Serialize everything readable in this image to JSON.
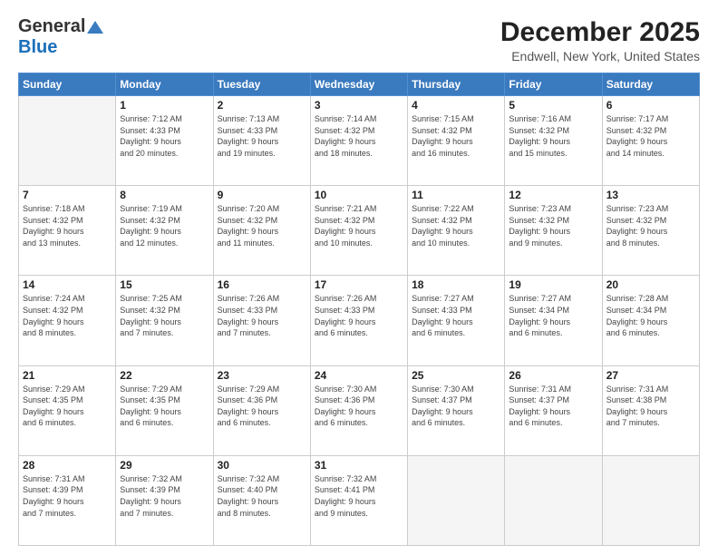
{
  "header": {
    "logo_general": "General",
    "logo_blue": "Blue",
    "main_title": "December 2025",
    "sub_title": "Endwell, New York, United States"
  },
  "days_of_week": [
    "Sunday",
    "Monday",
    "Tuesday",
    "Wednesday",
    "Thursday",
    "Friday",
    "Saturday"
  ],
  "weeks": [
    [
      {
        "day": "",
        "info": ""
      },
      {
        "day": "1",
        "info": "Sunrise: 7:12 AM\nSunset: 4:33 PM\nDaylight: 9 hours\nand 20 minutes."
      },
      {
        "day": "2",
        "info": "Sunrise: 7:13 AM\nSunset: 4:33 PM\nDaylight: 9 hours\nand 19 minutes."
      },
      {
        "day": "3",
        "info": "Sunrise: 7:14 AM\nSunset: 4:32 PM\nDaylight: 9 hours\nand 18 minutes."
      },
      {
        "day": "4",
        "info": "Sunrise: 7:15 AM\nSunset: 4:32 PM\nDaylight: 9 hours\nand 16 minutes."
      },
      {
        "day": "5",
        "info": "Sunrise: 7:16 AM\nSunset: 4:32 PM\nDaylight: 9 hours\nand 15 minutes."
      },
      {
        "day": "6",
        "info": "Sunrise: 7:17 AM\nSunset: 4:32 PM\nDaylight: 9 hours\nand 14 minutes."
      }
    ],
    [
      {
        "day": "7",
        "info": "Sunrise: 7:18 AM\nSunset: 4:32 PM\nDaylight: 9 hours\nand 13 minutes."
      },
      {
        "day": "8",
        "info": "Sunrise: 7:19 AM\nSunset: 4:32 PM\nDaylight: 9 hours\nand 12 minutes."
      },
      {
        "day": "9",
        "info": "Sunrise: 7:20 AM\nSunset: 4:32 PM\nDaylight: 9 hours\nand 11 minutes."
      },
      {
        "day": "10",
        "info": "Sunrise: 7:21 AM\nSunset: 4:32 PM\nDaylight: 9 hours\nand 10 minutes."
      },
      {
        "day": "11",
        "info": "Sunrise: 7:22 AM\nSunset: 4:32 PM\nDaylight: 9 hours\nand 10 minutes."
      },
      {
        "day": "12",
        "info": "Sunrise: 7:23 AM\nSunset: 4:32 PM\nDaylight: 9 hours\nand 9 minutes."
      },
      {
        "day": "13",
        "info": "Sunrise: 7:23 AM\nSunset: 4:32 PM\nDaylight: 9 hours\nand 8 minutes."
      }
    ],
    [
      {
        "day": "14",
        "info": "Sunrise: 7:24 AM\nSunset: 4:32 PM\nDaylight: 9 hours\nand 8 minutes."
      },
      {
        "day": "15",
        "info": "Sunrise: 7:25 AM\nSunset: 4:32 PM\nDaylight: 9 hours\nand 7 minutes."
      },
      {
        "day": "16",
        "info": "Sunrise: 7:26 AM\nSunset: 4:33 PM\nDaylight: 9 hours\nand 7 minutes."
      },
      {
        "day": "17",
        "info": "Sunrise: 7:26 AM\nSunset: 4:33 PM\nDaylight: 9 hours\nand 6 minutes."
      },
      {
        "day": "18",
        "info": "Sunrise: 7:27 AM\nSunset: 4:33 PM\nDaylight: 9 hours\nand 6 minutes."
      },
      {
        "day": "19",
        "info": "Sunrise: 7:27 AM\nSunset: 4:34 PM\nDaylight: 9 hours\nand 6 minutes."
      },
      {
        "day": "20",
        "info": "Sunrise: 7:28 AM\nSunset: 4:34 PM\nDaylight: 9 hours\nand 6 minutes."
      }
    ],
    [
      {
        "day": "21",
        "info": "Sunrise: 7:29 AM\nSunset: 4:35 PM\nDaylight: 9 hours\nand 6 minutes."
      },
      {
        "day": "22",
        "info": "Sunrise: 7:29 AM\nSunset: 4:35 PM\nDaylight: 9 hours\nand 6 minutes."
      },
      {
        "day": "23",
        "info": "Sunrise: 7:29 AM\nSunset: 4:36 PM\nDaylight: 9 hours\nand 6 minutes."
      },
      {
        "day": "24",
        "info": "Sunrise: 7:30 AM\nSunset: 4:36 PM\nDaylight: 9 hours\nand 6 minutes."
      },
      {
        "day": "25",
        "info": "Sunrise: 7:30 AM\nSunset: 4:37 PM\nDaylight: 9 hours\nand 6 minutes."
      },
      {
        "day": "26",
        "info": "Sunrise: 7:31 AM\nSunset: 4:37 PM\nDaylight: 9 hours\nand 6 minutes."
      },
      {
        "day": "27",
        "info": "Sunrise: 7:31 AM\nSunset: 4:38 PM\nDaylight: 9 hours\nand 7 minutes."
      }
    ],
    [
      {
        "day": "28",
        "info": "Sunrise: 7:31 AM\nSunset: 4:39 PM\nDaylight: 9 hours\nand 7 minutes."
      },
      {
        "day": "29",
        "info": "Sunrise: 7:32 AM\nSunset: 4:39 PM\nDaylight: 9 hours\nand 7 minutes."
      },
      {
        "day": "30",
        "info": "Sunrise: 7:32 AM\nSunset: 4:40 PM\nDaylight: 9 hours\nand 8 minutes."
      },
      {
        "day": "31",
        "info": "Sunrise: 7:32 AM\nSunset: 4:41 PM\nDaylight: 9 hours\nand 9 minutes."
      },
      {
        "day": "",
        "info": ""
      },
      {
        "day": "",
        "info": ""
      },
      {
        "day": "",
        "info": ""
      }
    ]
  ]
}
